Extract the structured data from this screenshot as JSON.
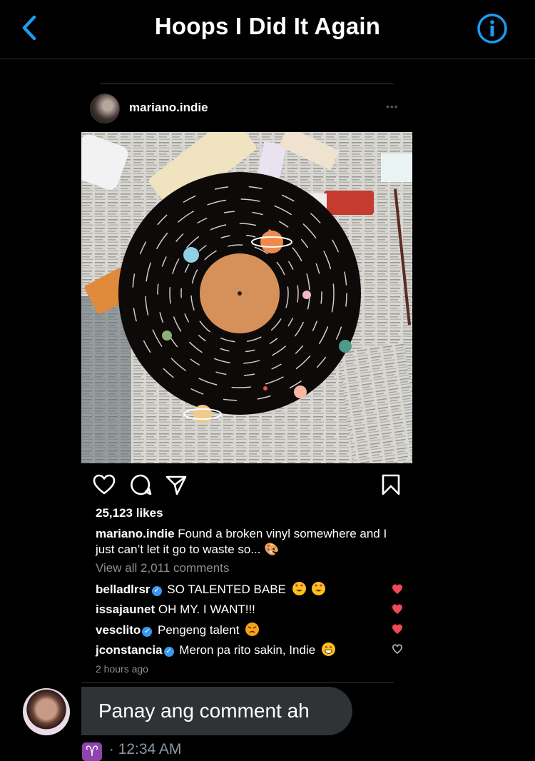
{
  "header": {
    "title": "Hoops I Did It Again",
    "back_icon": "chevron-left-icon",
    "info_icon": "info-icon",
    "accent": "#1d9bf0"
  },
  "post": {
    "username": "mariano.indie",
    "likes": "25,123 likes",
    "caption_user": "mariano.indie",
    "caption_text": "Found a broken vinyl somewhere and I just can’t let it go to waste so... 🎨",
    "view_all": "View all 2,011 comments",
    "comments": [
      {
        "user": "belladlrsr",
        "verified": true,
        "text": "SO TALENTED BABE",
        "liked": true
      },
      {
        "user": "issajaunet",
        "verified": false,
        "text": "OH MY. I WANT!!!",
        "liked": true
      },
      {
        "user": "vesclito",
        "verified": true,
        "text": "Pengeng talent",
        "liked": true
      },
      {
        "user": "jconstancia",
        "verified": true,
        "text": "Meron pa rito sakin, Indie",
        "liked": false
      }
    ],
    "time_ago": "2 hours ago"
  },
  "message": {
    "text": "Panay ang comment ah",
    "zodiac": "♈",
    "separator": "·",
    "time": "12:34 AM"
  },
  "colors": {
    "like_red": "#ed4956",
    "muted": "#8e8e8e",
    "bubble": "#2f3336",
    "verified_blue": "#3897f0"
  }
}
